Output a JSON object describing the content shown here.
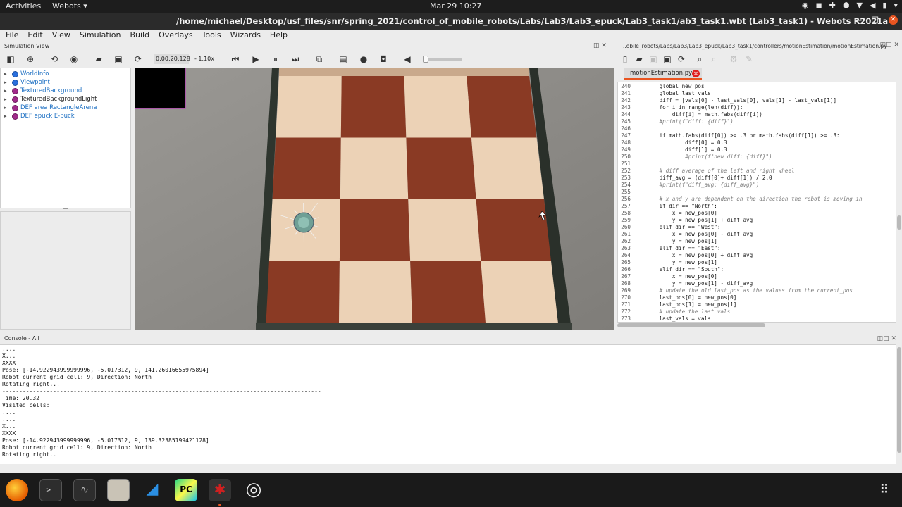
{
  "topbar": {
    "activities": "Activities",
    "app_menu": "Webots ▾",
    "clock": "Mar 29  10:27"
  },
  "window": {
    "title": "/home/michael/Desktop/usf_files/snr/spring_2021/control_of_mobile_robots/Labs/Lab3/Lab3_epuck/Lab3_task1/ab3_task1.wbt (Lab3_task1) - Webots R2021a"
  },
  "menu": [
    "File",
    "Edit",
    "View",
    "Simulation",
    "Build",
    "Overlays",
    "Tools",
    "Wizards",
    "Help"
  ],
  "simulation_view": {
    "label": "Simulation View",
    "time": "0:00:20:128",
    "speed": "- 1.10x"
  },
  "scene_tree": [
    {
      "label": "WorldInfo",
      "color": "blue"
    },
    {
      "label": "Viewpoint",
      "color": "blue"
    },
    {
      "label": "TexturedBackground",
      "color": "pink"
    },
    {
      "label": "TexturedBackgroundLight",
      "color": "pink"
    },
    {
      "label": "DEF area RectangleArena",
      "color": "pink"
    },
    {
      "label": "DEF epuck E-puck",
      "color": "pink"
    }
  ],
  "editor": {
    "path": "..obile_robots/Labs/Lab3/Lab3_epuck/Lab3_task1/controllers/motionEstimation/motionEstimation.py",
    "tab": "motionEstimation.py",
    "lines": [
      {
        "n": "240",
        "t": "        global new_pos",
        "k": ""
      },
      {
        "n": "241",
        "t": "        global last_vals",
        "k": ""
      },
      {
        "n": "242",
        "t": "        diff = [vals[0] - last_vals[0], vals[1] - last_vals[1]]",
        "k": ""
      },
      {
        "n": "243",
        "t": "        for i in range(len(diff)):",
        "k": ""
      },
      {
        "n": "244",
        "t": "            diff[i] = math.fabs(diff[i])",
        "k": ""
      },
      {
        "n": "245",
        "t": "        #print(f\"diff: {diff}\")",
        "k": "comment"
      },
      {
        "n": "246",
        "t": "",
        "k": ""
      },
      {
        "n": "247",
        "t": "        if math.fabs(diff[0]) >= .3 or math.fabs(diff[1]) >= .3:",
        "k": ""
      },
      {
        "n": "248",
        "t": "                diff[0] = 0.3",
        "k": ""
      },
      {
        "n": "249",
        "t": "                diff[1] = 0.3",
        "k": ""
      },
      {
        "n": "250",
        "t": "                #print(f\"new diff: {diff}\")",
        "k": "comment"
      },
      {
        "n": "251",
        "t": "",
        "k": ""
      },
      {
        "n": "252",
        "t": "        # diff average of the left and right wheel",
        "k": "comment"
      },
      {
        "n": "253",
        "t": "        diff_avg = (diff[0]+ diff[1]) / 2.0",
        "k": ""
      },
      {
        "n": "254",
        "t": "        #print(f\"diff_avg: {diff_avg}\")",
        "k": "comment"
      },
      {
        "n": "255",
        "t": "",
        "k": ""
      },
      {
        "n": "256",
        "t": "        # x and y are dependent on the direction the robot is moving in",
        "k": "comment"
      },
      {
        "n": "257",
        "t": "        if dir == \"North\":",
        "k": ""
      },
      {
        "n": "258",
        "t": "            x = new_pos[0]",
        "k": ""
      },
      {
        "n": "259",
        "t": "            y = new_pos[1] + diff_avg",
        "k": ""
      },
      {
        "n": "260",
        "t": "        elif dir == \"West\":",
        "k": ""
      },
      {
        "n": "261",
        "t": "            x = new_pos[0] - diff_avg",
        "k": ""
      },
      {
        "n": "262",
        "t": "            y = new_pos[1]",
        "k": ""
      },
      {
        "n": "263",
        "t": "        elif dir == \"East\":",
        "k": ""
      },
      {
        "n": "264",
        "t": "            x = new_pos[0] + diff_avg",
        "k": ""
      },
      {
        "n": "265",
        "t": "            y = new_pos[1]",
        "k": ""
      },
      {
        "n": "266",
        "t": "        elif dir == \"South\":",
        "k": ""
      },
      {
        "n": "267",
        "t": "            x = new_pos[0]",
        "k": ""
      },
      {
        "n": "268",
        "t": "            y = new_pos[1] - diff_avg",
        "k": ""
      },
      {
        "n": "269",
        "t": "        # update the old last_pos as the values from the current_pos",
        "k": "comment"
      },
      {
        "n": "270",
        "t": "        last_pos[0] = new_pos[0]",
        "k": ""
      },
      {
        "n": "271",
        "t": "        last_pos[1] = new_pos[1]",
        "k": ""
      },
      {
        "n": "272",
        "t": "        # update the last vals",
        "k": "comment"
      },
      {
        "n": "273",
        "t": "        last_vals = vals",
        "k": ""
      }
    ]
  },
  "console": {
    "label": "Console - All",
    "lines": [
      "....",
      "X...",
      "XXXX",
      "Pose: [-14.922943999999996, -5.017312, 9, 141.26016655975894]",
      "Robot current grid cell: 9, Direction: North",
      "Rotating right...",
      "----------------------------------------------------------------------------------------------",
      "Time: 20.32",
      "Visited cells:",
      "....",
      "....",
      "X...",
      "XXXX",
      "Pose: [-14.922943999999996, -5.017312, 9, 139.32385199421128]",
      "Robot current grid cell: 9, Direction: North",
      "Rotating right..."
    ]
  },
  "colors": {
    "accent": "#e95420",
    "wood_dark": "#8a3a24",
    "wood_light": "#ecd2b6"
  }
}
